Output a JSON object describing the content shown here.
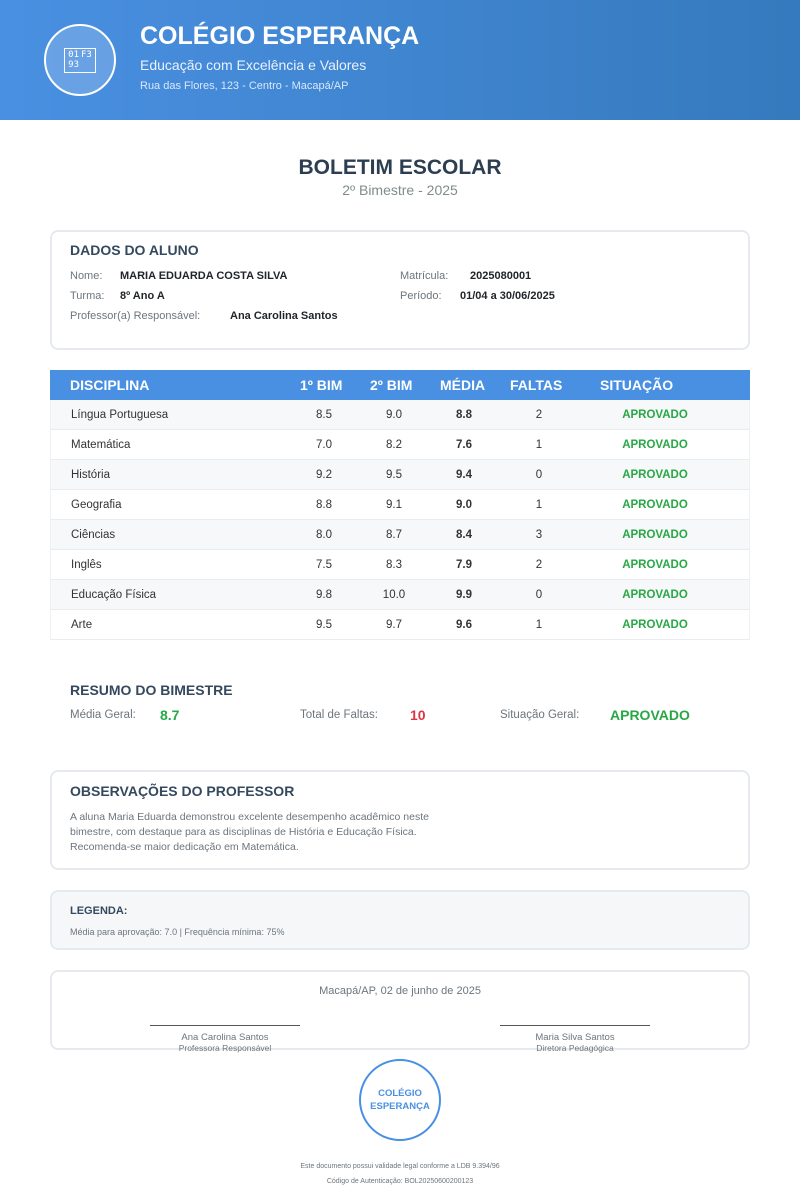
{
  "header": {
    "logo_glyph": [
      "01",
      "F3",
      "93"
    ],
    "school_name": "COLÉGIO ESPERANÇA",
    "tagline": "Educação com Excelência e Valores",
    "address": "Rua das Flores, 123 - Centro - Macapá/AP"
  },
  "document": {
    "title": "BOLETIM ESCOLAR",
    "subtitle": "2º Bimestre - 2025"
  },
  "student": {
    "section_title": "DADOS DO ALUNO",
    "name_label": "Nome:",
    "name": "MARIA EDUARDA COSTA SILVA",
    "class_label": "Turma:",
    "class": "8º Ano A",
    "teacher_label": "Professor(a) Responsável:",
    "teacher": "Ana Carolina Santos",
    "enrollment_label": "Matrícula:",
    "enrollment": "2025080001",
    "period_label": "Período:",
    "period": "01/04 a 30/06/2025"
  },
  "grades": {
    "headers": [
      "DISCIPLINA",
      "1º BIM",
      "2º BIM",
      "MÉDIA",
      "FALTAS",
      "SITUAÇÃO"
    ],
    "rows": [
      {
        "subject": "Língua Portuguesa",
        "b1": "8.5",
        "b2": "9.0",
        "avg": "8.8",
        "absences": "2",
        "status": "APROVADO"
      },
      {
        "subject": "Matemática",
        "b1": "7.0",
        "b2": "8.2",
        "avg": "7.6",
        "absences": "1",
        "status": "APROVADO"
      },
      {
        "subject": "História",
        "b1": "9.2",
        "b2": "9.5",
        "avg": "9.4",
        "absences": "0",
        "status": "APROVADO"
      },
      {
        "subject": "Geografia",
        "b1": "8.8",
        "b2": "9.1",
        "avg": "9.0",
        "absences": "1",
        "status": "APROVADO"
      },
      {
        "subject": "Ciências",
        "b1": "8.0",
        "b2": "8.7",
        "avg": "8.4",
        "absences": "3",
        "status": "APROVADO"
      },
      {
        "subject": "Inglês",
        "b1": "7.5",
        "b2": "8.3",
        "avg": "7.9",
        "absences": "2",
        "status": "APROVADO"
      },
      {
        "subject": "Educação Física",
        "b1": "9.8",
        "b2": "10.0",
        "avg": "9.9",
        "absences": "0",
        "status": "APROVADO"
      },
      {
        "subject": "Arte",
        "b1": "9.5",
        "b2": "9.7",
        "avg": "9.6",
        "absences": "1",
        "status": "APROVADO"
      }
    ]
  },
  "summary": {
    "title": "RESUMO DO BIMESTRE",
    "avg_label": "Média Geral:",
    "avg_value": "8.7",
    "absences_label": "Total de Faltas:",
    "absences_value": "10",
    "status_label": "Situação Geral:",
    "status_value": "APROVADO"
  },
  "observations": {
    "title": "OBSERVAÇÕES DO PROFESSOR",
    "text": "A aluna Maria Eduarda demonstrou excelente desempenho acadêmico neste bimestre, com destaque para as disciplinas de História e Educação Física. Recomenda-se maior dedicação em Matemática."
  },
  "legend": {
    "title": "LEGENDA:",
    "text": "Média para aprovação: 7.0 | Frequência mínima: 75%"
  },
  "signatures": {
    "place_date": "Macapá/AP, 02 de junho de 2025",
    "left_name": "Ana Carolina Santos",
    "left_role": "Professora Responsável",
    "right_name": "Maria Silva Santos",
    "right_role": "Diretora Pedagógica"
  },
  "seal": {
    "line1": "COLÉGIO",
    "line2": "ESPERANÇA"
  },
  "footer": {
    "legal": "Este documento possui validade legal conforme a LDB 9.394/96",
    "auth": "Código de Autenticação: BOL20250600200123"
  },
  "colors": {
    "primary": "#4a90e2",
    "approved": "#28a745",
    "absences_total": "#dc3545"
  }
}
